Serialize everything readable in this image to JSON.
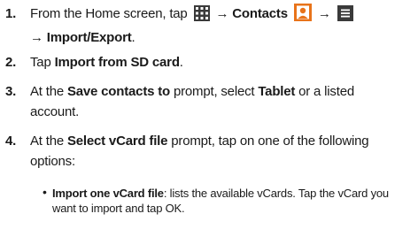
{
  "steps": [
    {
      "number": "1.",
      "line1": {
        "t1": "From the Home screen, tap",
        "arrow1": "→",
        "contacts": "Contacts",
        "arrow2": "→"
      },
      "line2": {
        "arrow": "→",
        "import_export": "Import/Export",
        "period": "."
      },
      "icons": [
        "apps-grid-icon",
        "contacts-icon",
        "menu-icon"
      ],
      "colors": {
        "apps": "#3a3a3a",
        "contacts": "#e8731a",
        "menu": "#3a3a3a"
      }
    },
    {
      "number": "2.",
      "t1": "Tap",
      "bold": "Import from SD card",
      "end": "."
    },
    {
      "number": "3.",
      "t1": "At the",
      "bold1": "Save contacts to",
      "t2": "prompt, select",
      "bold2": "Tablet",
      "t3": "or a listed",
      "line2": "account."
    },
    {
      "number": "4.",
      "t1": "At the",
      "bold1": "Select vCard file",
      "t2": "prompt, tap on one of the following",
      "line2": "options:"
    }
  ],
  "bullet": {
    "symbol": "•",
    "bold": "Import one vCard file",
    "text1": ": lists the available vCards. Tap the vCard you",
    "text2": "want to import and tap OK."
  }
}
